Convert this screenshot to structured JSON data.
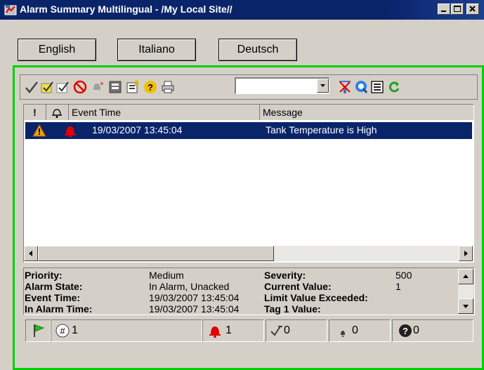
{
  "window": {
    "title": "Alarm Summary Multilingual - /My Local Site//",
    "titlebar_color": "#0a246a"
  },
  "languages": [
    "English",
    "Italiano",
    "Deutsch"
  ],
  "frame_color": "#00d000",
  "toolbar": {
    "icons": [
      "ack-check-icon",
      "ack-all-icon",
      "ack-selected-icon",
      "disable-icon",
      "silence-icon",
      "comment-icon",
      "properties-icon",
      "help-icon",
      "print-icon"
    ],
    "filter_value": "",
    "right_icons": [
      "clear-filter-icon",
      "find-icon",
      "details-icon",
      "refresh-icon"
    ]
  },
  "list": {
    "headers": [
      "!",
      "",
      "Event Time",
      "Message"
    ],
    "rows": [
      {
        "priority_icon": "warning-icon",
        "state_icon": "red-bell-icon",
        "event_time": "19/03/2007 13:45:04",
        "message": "Tank Temperature is High",
        "selected": true
      }
    ]
  },
  "details": {
    "left": [
      {
        "label": "Priority:",
        "value": "Medium"
      },
      {
        "label": "Alarm State:",
        "value": "In Alarm, Unacked"
      },
      {
        "label": "Event Time:",
        "value": "19/03/2007 13:45:04"
      },
      {
        "label": "In Alarm Time:",
        "value": "19/03/2007 13:45:04"
      }
    ],
    "right": [
      {
        "label": "Severity:",
        "value": "500"
      },
      {
        "label": "Current Value:",
        "value": "1"
      },
      {
        "label": "Limit Value Exceeded:",
        "value": ""
      },
      {
        "label": "Tag 1 Value:",
        "value": ""
      }
    ]
  },
  "statusbar": {
    "total": "1",
    "in_alarm": "1",
    "acked": "0",
    "unacked": "0",
    "unknown": "0"
  }
}
